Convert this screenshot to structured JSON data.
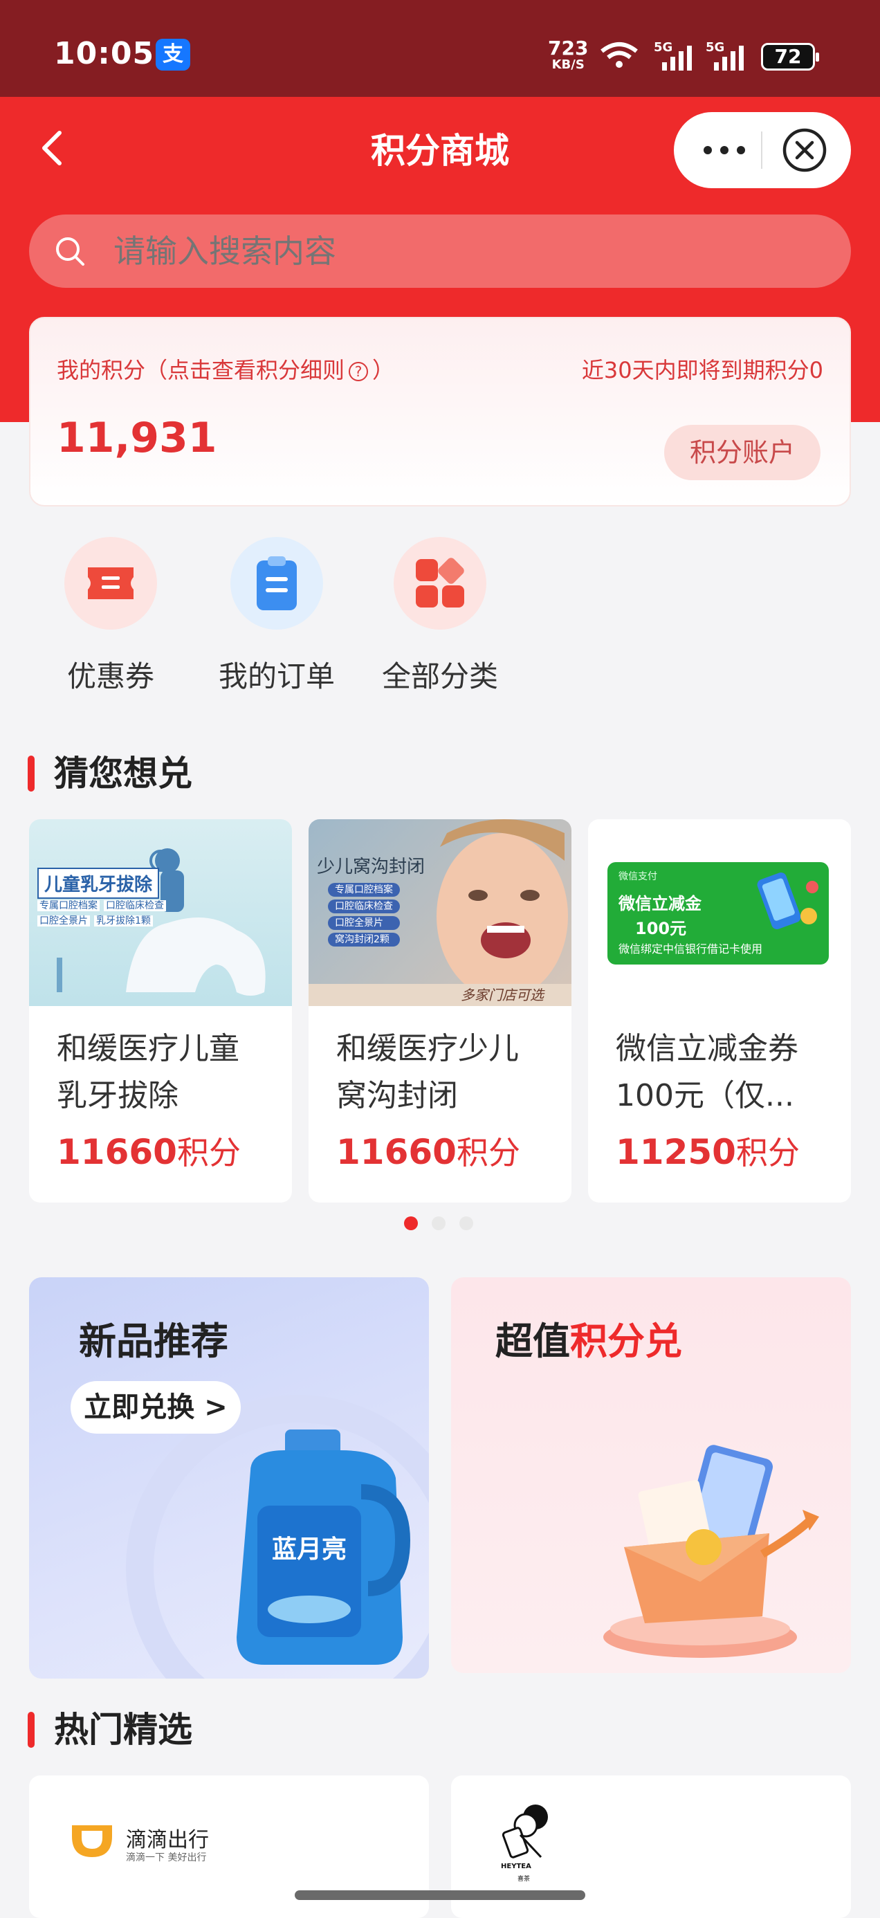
{
  "status_bar": {
    "time": "10:05",
    "app_badge": "支",
    "net_speed_value": "723",
    "net_speed_unit": "KB/S",
    "signal_1": "5G",
    "signal_2": "5G",
    "battery": "72"
  },
  "header": {
    "title": "积分商城",
    "back_icon": "chevron-left-icon",
    "more_icon": "ellipsis-icon",
    "close_icon": "close-circle-icon"
  },
  "search": {
    "placeholder": "请输入搜索内容",
    "icon": "search-icon"
  },
  "points": {
    "label": "我的积分（点击查看积分细则",
    "label_end": "）",
    "expiring": "近30天内即将到期积分0",
    "value": "11,931",
    "account_button": "积分账户"
  },
  "shortcuts": [
    {
      "label": "优惠券",
      "icon": "coupon-icon"
    },
    {
      "label": "我的订单",
      "icon": "clipboard-icon"
    },
    {
      "label": "全部分类",
      "icon": "category-grid-icon"
    }
  ],
  "guess_section": {
    "title": "猜您想兑"
  },
  "products": [
    {
      "name_line1": "和缓医疗儿童",
      "name_line2": "乳牙拔除",
      "price": "11660",
      "unit": "积分",
      "image": {
        "heading": "儿童乳牙拔除",
        "tags": [
          "专属口腔档案",
          "口腔临床检查",
          "口腔全景片",
          "乳牙拔除1颗"
        ]
      }
    },
    {
      "name_line1": "和缓医疗少儿",
      "name_line2": "窝沟封闭",
      "price": "11660",
      "unit": "积分",
      "image": {
        "heading": "少儿窝沟封闭",
        "tags": [
          "专属口腔档案",
          "口腔临床检查",
          "口腔全景片",
          "窝沟封闭2颗"
        ],
        "footer": "多家门店可选"
      }
    },
    {
      "name_line1": "微信立减金券",
      "name_line2": "100元（仅...",
      "price": "11250",
      "unit": "积分",
      "image": {
        "brand": "微信支付",
        "heading": "微信立减金",
        "amount": "100元",
        "footer": "微信绑定中信银行借记卡使用"
      }
    }
  ],
  "carousel": {
    "page_count": 3,
    "active_index": 0
  },
  "banners": {
    "new": {
      "title": "新品推荐",
      "button": "立即兑换 >",
      "product_brand": "蓝月亮"
    },
    "value": {
      "title_part1": "超值",
      "title_part2": "积分兑"
    }
  },
  "hot_section": {
    "title": "热门精选"
  },
  "hot_items": [
    {
      "brand": "滴滴出行",
      "slogan": "滴滴一下 美好出行"
    },
    {
      "brand": "HEYTEA",
      "brand_cn": "喜茶"
    }
  ],
  "colors": {
    "primary_red": "#ee2a2b",
    "status_bar": "#851d22",
    "price_red": "#e33234"
  }
}
